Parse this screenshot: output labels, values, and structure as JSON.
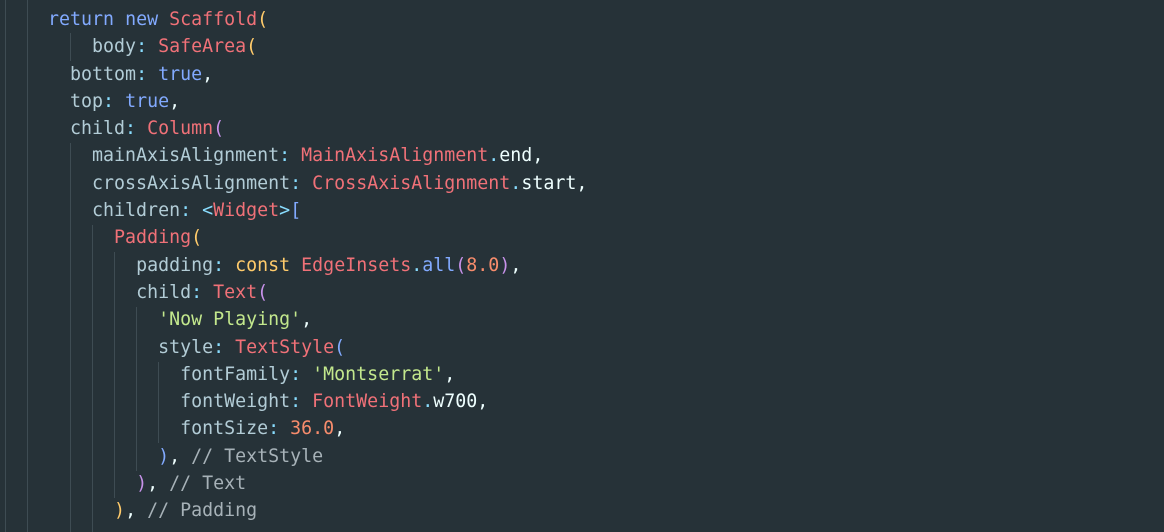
{
  "editor": {
    "lines": [
      [
        {
          "t": "return",
          "c": "tok-kw"
        },
        {
          "t": " ",
          "c": "tok-plain"
        },
        {
          "t": "new",
          "c": "tok-kw"
        },
        {
          "t": " ",
          "c": "tok-plain"
        },
        {
          "t": "Scaffold",
          "c": "tok-class"
        },
        {
          "t": "(",
          "c": "tok-brk-y"
        }
      ],
      [
        {
          "t": "    ",
          "c": "tok-plain"
        },
        {
          "t": "body",
          "c": "tok-prop"
        },
        {
          "t": ": ",
          "c": "tok-punc"
        },
        {
          "t": "SafeArea",
          "c": "tok-class"
        },
        {
          "t": "(",
          "c": "tok-brk-y"
        }
      ],
      [
        {
          "t": "  ",
          "c": "tok-plain"
        },
        {
          "t": "bottom",
          "c": "tok-prop"
        },
        {
          "t": ": ",
          "c": "tok-punc"
        },
        {
          "t": "true",
          "c": "tok-bool"
        },
        {
          "t": ",",
          "c": "tok-plain"
        }
      ],
      [
        {
          "t": "  ",
          "c": "tok-plain"
        },
        {
          "t": "top",
          "c": "tok-prop"
        },
        {
          "t": ": ",
          "c": "tok-punc"
        },
        {
          "t": "true",
          "c": "tok-bool"
        },
        {
          "t": ",",
          "c": "tok-plain"
        }
      ],
      [
        {
          "t": "  ",
          "c": "tok-plain"
        },
        {
          "t": "child",
          "c": "tok-prop"
        },
        {
          "t": ": ",
          "c": "tok-punc"
        },
        {
          "t": "Column",
          "c": "tok-class"
        },
        {
          "t": "(",
          "c": "tok-brk-p"
        }
      ],
      [
        {
          "t": "    ",
          "c": "tok-plain"
        },
        {
          "t": "mainAxisAlignment",
          "c": "tok-prop"
        },
        {
          "t": ": ",
          "c": "tok-punc"
        },
        {
          "t": "MainAxisAlignment",
          "c": "tok-class"
        },
        {
          "t": ".",
          "c": "tok-punc"
        },
        {
          "t": "end",
          "c": "tok-plain"
        },
        {
          "t": ",",
          "c": "tok-plain"
        }
      ],
      [
        {
          "t": "    ",
          "c": "tok-plain"
        },
        {
          "t": "crossAxisAlignment",
          "c": "tok-prop"
        },
        {
          "t": ": ",
          "c": "tok-punc"
        },
        {
          "t": "CrossAxisAlignment",
          "c": "tok-class"
        },
        {
          "t": ".",
          "c": "tok-punc"
        },
        {
          "t": "start",
          "c": "tok-plain"
        },
        {
          "t": ",",
          "c": "tok-plain"
        }
      ],
      [
        {
          "t": "    ",
          "c": "tok-plain"
        },
        {
          "t": "children",
          "c": "tok-prop"
        },
        {
          "t": ": ",
          "c": "tok-punc"
        },
        {
          "t": "<",
          "c": "tok-punc"
        },
        {
          "t": "Widget",
          "c": "tok-class"
        },
        {
          "t": ">",
          "c": "tok-punc"
        },
        {
          "t": "[",
          "c": "tok-brk-b"
        }
      ],
      [
        {
          "t": "      ",
          "c": "tok-plain"
        },
        {
          "t": "Padding",
          "c": "tok-class"
        },
        {
          "t": "(",
          "c": "tok-brk-y"
        }
      ],
      [
        {
          "t": "        ",
          "c": "tok-plain"
        },
        {
          "t": "padding",
          "c": "tok-prop"
        },
        {
          "t": ": ",
          "c": "tok-punc"
        },
        {
          "t": "const",
          "c": "tok-const"
        },
        {
          "t": " ",
          "c": "tok-plain"
        },
        {
          "t": "EdgeInsets",
          "c": "tok-class"
        },
        {
          "t": ".",
          "c": "tok-punc"
        },
        {
          "t": "all",
          "c": "tok-fn"
        },
        {
          "t": "(",
          "c": "tok-brk-p"
        },
        {
          "t": "8.0",
          "c": "tok-num"
        },
        {
          "t": ")",
          "c": "tok-brk-p"
        },
        {
          "t": ",",
          "c": "tok-plain"
        }
      ],
      [
        {
          "t": "        ",
          "c": "tok-plain"
        },
        {
          "t": "child",
          "c": "tok-prop"
        },
        {
          "t": ": ",
          "c": "tok-punc"
        },
        {
          "t": "Text",
          "c": "tok-class"
        },
        {
          "t": "(",
          "c": "tok-brk-p"
        }
      ],
      [
        {
          "t": "          ",
          "c": "tok-plain"
        },
        {
          "t": "'Now Playing'",
          "c": "tok-str"
        },
        {
          "t": ",",
          "c": "tok-plain"
        }
      ],
      [
        {
          "t": "          ",
          "c": "tok-plain"
        },
        {
          "t": "style",
          "c": "tok-prop"
        },
        {
          "t": ": ",
          "c": "tok-punc"
        },
        {
          "t": "TextStyle",
          "c": "tok-class"
        },
        {
          "t": "(",
          "c": "tok-brk-b"
        }
      ],
      [
        {
          "t": "            ",
          "c": "tok-plain"
        },
        {
          "t": "fontFamily",
          "c": "tok-prop"
        },
        {
          "t": ": ",
          "c": "tok-punc"
        },
        {
          "t": "'Montserrat'",
          "c": "tok-str"
        },
        {
          "t": ",",
          "c": "tok-plain"
        }
      ],
      [
        {
          "t": "            ",
          "c": "tok-plain"
        },
        {
          "t": "fontWeight",
          "c": "tok-prop"
        },
        {
          "t": ": ",
          "c": "tok-punc"
        },
        {
          "t": "FontWeight",
          "c": "tok-class"
        },
        {
          "t": ".",
          "c": "tok-punc"
        },
        {
          "t": "w700",
          "c": "tok-plain"
        },
        {
          "t": ",",
          "c": "tok-plain"
        }
      ],
      [
        {
          "t": "            ",
          "c": "tok-plain"
        },
        {
          "t": "fontSize",
          "c": "tok-prop"
        },
        {
          "t": ": ",
          "c": "tok-punc"
        },
        {
          "t": "36.0",
          "c": "tok-num"
        },
        {
          "t": ",",
          "c": "tok-plain"
        }
      ],
      [
        {
          "t": "          ",
          "c": "tok-plain"
        },
        {
          "t": ")",
          "c": "tok-brk-b"
        },
        {
          "t": ", ",
          "c": "tok-plain"
        },
        {
          "t": "// TextStyle",
          "c": "tok-com"
        }
      ],
      [
        {
          "t": "        ",
          "c": "tok-plain"
        },
        {
          "t": ")",
          "c": "tok-brk-p"
        },
        {
          "t": ", ",
          "c": "tok-plain"
        },
        {
          "t": "// Text",
          "c": "tok-com"
        }
      ],
      [
        {
          "t": "      ",
          "c": "tok-plain"
        },
        {
          "t": ")",
          "c": "tok-brk-y"
        },
        {
          "t": ", ",
          "c": "tok-plain"
        },
        {
          "t": "// Padding",
          "c": "tok-com"
        }
      ]
    ]
  },
  "colors": {
    "background": "#263238",
    "guide": "#3E4C53"
  }
}
